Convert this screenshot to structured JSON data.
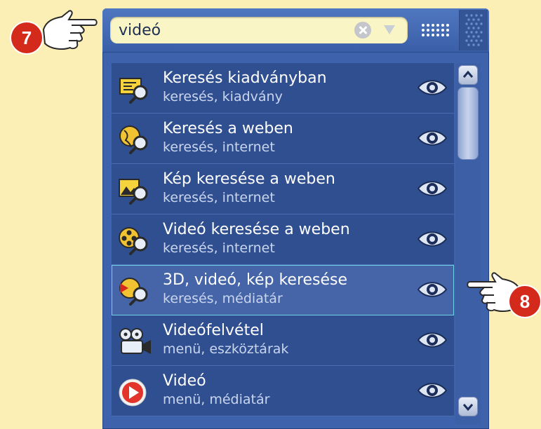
{
  "search": {
    "value": "videó"
  },
  "results": [
    {
      "title": "Keresés kiadványban",
      "subtitle": "keresés, kiadvány",
      "icon": "publication-search-icon"
    },
    {
      "title": "Keresés a weben",
      "subtitle": "keresés, internet",
      "icon": "web-search-icon"
    },
    {
      "title": "Kép keresése a weben",
      "subtitle": "keresés, internet",
      "icon": "image-search-icon"
    },
    {
      "title": "Videó keresése a weben",
      "subtitle": "keresés, internet",
      "icon": "video-search-icon"
    },
    {
      "title": "3D, videó, kép keresése",
      "subtitle": "keresés, médiatár",
      "icon": "media-search-icon",
      "selected": true
    },
    {
      "title": "Videófelvétel",
      "subtitle": "menü, eszköztárak",
      "icon": "video-camera-icon"
    },
    {
      "title": "Videó",
      "subtitle": "menü, médiatár",
      "icon": "video-play-icon"
    }
  ],
  "callouts": [
    {
      "number": "7",
      "target": "search-input"
    },
    {
      "number": "8",
      "target": "result-row-5"
    }
  ],
  "colors": {
    "accent": "#d42a1c",
    "panel": "#3e63ac",
    "row": "#2f4f91",
    "selected_outline": "#6fd3e6",
    "background": "#fcefb6"
  }
}
